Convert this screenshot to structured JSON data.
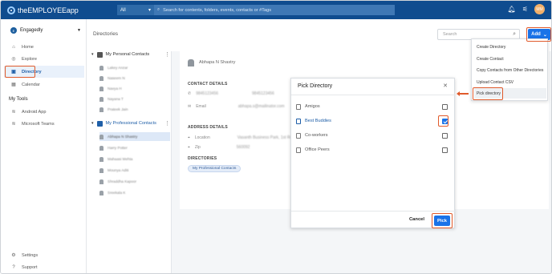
{
  "app": {
    "logo_text": "theEMPLOYEEapp"
  },
  "topbar": {
    "scope_label": "All",
    "search_placeholder": "Search for contents, folders, events, contacts or #Tags",
    "avatar_initials": "MM"
  },
  "sidebar": {
    "org_name": "Engagedly",
    "items": [
      {
        "label": "Home",
        "icon": "home-icon"
      },
      {
        "label": "Explore",
        "icon": "compass-icon"
      },
      {
        "label": "Directory",
        "icon": "contacts-icon"
      },
      {
        "label": "Calendar",
        "icon": "calendar-icon"
      }
    ],
    "tools_title": "My Tools",
    "tools": [
      {
        "label": "Android App",
        "icon": "layers-icon"
      },
      {
        "label": "Microsoft Teams",
        "icon": "layers-icon"
      }
    ],
    "bottom": [
      {
        "label": "Settings",
        "icon": "gear-icon"
      },
      {
        "label": "Support",
        "icon": "help-icon"
      }
    ]
  },
  "header": {
    "title": "Directories",
    "search_placeholder": "Search",
    "add_label": "Add"
  },
  "directories": {
    "personal_title": "My Personal Contacts",
    "personal_contacts": [
      "Lakey Anzar",
      "Naseem N",
      "Navya H",
      "Nayana T",
      "Prateek Jain"
    ],
    "professional_title": "My Professional Contacts",
    "professional_contacts": [
      "Abhapa N Shastry",
      "Harry Potter",
      "Mahaasi Mehta",
      "Mounya Aditi",
      "Shraddha Kapoor",
      "Sreekala K"
    ]
  },
  "detail": {
    "name": "Abhapa N Shastry",
    "contact_details_title": "CONTACT DETAILS",
    "phone_1": "9845123456",
    "phone_2": "9845123456",
    "email_label": "Email",
    "email_value": "abhapa.s@mailinator.com",
    "address_title": "ADDRESS DETAILS",
    "location_label": "Location",
    "location_value": "Vasanth Business Park, 1st Road",
    "zip_label": "Zip",
    "zip_value": "560092",
    "directories_title": "DIRECTORIES",
    "directory_chip": "My Professional Contacts"
  },
  "modal": {
    "title": "Pick Directory",
    "items": [
      {
        "label": "Amigos",
        "checked": false
      },
      {
        "label": "Best Buddies",
        "checked": true
      },
      {
        "label": "Co-workers",
        "checked": false
      },
      {
        "label": "Office Peers",
        "checked": false
      }
    ],
    "cancel_label": "Cancel",
    "pick_label": "Pick"
  },
  "add_menu": {
    "items": [
      "Create Directory",
      "Create Contact",
      "Copy Contacts from Other Directories",
      "Upload Contact CSV",
      "Pick directory"
    ]
  },
  "colors": {
    "topbar": "#0f4c8f",
    "accent": "#1a73e8",
    "highlight": "#e05a2b"
  }
}
